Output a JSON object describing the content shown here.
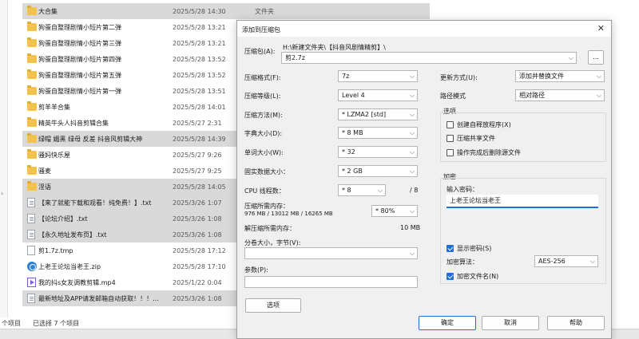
{
  "explorer": {
    "files": [
      {
        "name": "大合集",
        "date": "2025/5/28 14:30",
        "type": "文件夹",
        "icon": "folder-icon",
        "selected": true
      },
      {
        "name": "狗蛋自整理剧情小短片第二弹",
        "date": "2025/5/28 13:21",
        "type": "",
        "icon": "folder-icon",
        "selected": false
      },
      {
        "name": "狗蛋自整理剧情小短片第三弹",
        "date": "2025/5/28 13:21",
        "type": "",
        "icon": "folder-icon",
        "selected": false
      },
      {
        "name": "狗蛋自整理剧情小短片第四弹",
        "date": "2025/5/28 13:52",
        "type": "",
        "icon": "folder-icon",
        "selected": false
      },
      {
        "name": "狗蛋自整理剧情小短片第五弹",
        "date": "2025/5/28 13:52",
        "type": "",
        "icon": "folder-icon",
        "selected": false
      },
      {
        "name": "狗蛋自整理剧情小短片第一弹",
        "date": "2025/5/28 13:51",
        "type": "",
        "icon": "folder-icon",
        "selected": false
      },
      {
        "name": "剪羊羊合集",
        "date": "2025/5/28 14:01",
        "type": "",
        "icon": "folder-icon",
        "selected": false
      },
      {
        "name": "精英牛头人抖音剪辑合集",
        "date": "2025/5/27 2:31",
        "type": "",
        "icon": "folder-icon",
        "selected": false
      },
      {
        "name": "绿帽 媚黑 绿母 反差 抖音风剪辑大神",
        "date": "2025/5/28 14:39",
        "type": "",
        "icon": "folder-icon",
        "selected": true
      },
      {
        "name": "骚妈快乐屋",
        "date": "2025/5/27 9:26",
        "type": "",
        "icon": "folder-icon",
        "selected": false
      },
      {
        "name": "骚麦",
        "date": "2025/5/27 9:25",
        "type": "",
        "icon": "folder-icon",
        "selected": false
      },
      {
        "name": "淫语",
        "date": "2025/5/28 14:05",
        "type": "",
        "icon": "folder-icon",
        "selected": true
      },
      {
        "name": "【来了就能下载和观看！纯免费！】.txt",
        "date": "2025/3/26 1:07",
        "type": "",
        "icon": "txt-icon",
        "selected": true
      },
      {
        "name": "【论坛介绍】.txt",
        "date": "2025/3/26 1:08",
        "type": "",
        "icon": "txt-icon",
        "selected": true
      },
      {
        "name": "【永久地址发布页】.txt",
        "date": "2025/3/26 1:08",
        "type": "",
        "icon": "txt-icon",
        "selected": true
      },
      {
        "name": "剪1.7z.tmp",
        "date": "2025/5/28 17:12",
        "type": "",
        "icon": "tmp-icon",
        "selected": false
      },
      {
        "name": "上老王论坛当老王.zip",
        "date": "2025/5/28 17:10",
        "type": "",
        "icon": "zip-icon",
        "selected": false
      },
      {
        "name": "我的抖s女友调教剪辑.mp4",
        "date": "2025/1/22 0:04",
        "type": "",
        "icon": "mp4-icon",
        "selected": false
      },
      {
        "name": "最新地址及APP请发邮箱自动获取！！！...",
        "date": "2025/3/26 1:08",
        "type": "",
        "icon": "txt-icon",
        "selected": true
      }
    ],
    "status_count": "个项目",
    "status_selected": "已选择 7 个项目"
  },
  "dialog": {
    "title": "添加到压缩包",
    "close_glyph": "✕",
    "archive_label": "压缩包(A):",
    "archive_path": "H:\\新建文件夹\\【抖音风剧情精剪】\\",
    "archive_name": "剪2.7z",
    "browse_label": "...",
    "format_label": "压缩格式(F):",
    "format_value": "7z",
    "level_label": "压缩等级(L):",
    "level_value": "Level 4",
    "method_label": "压缩方法(M):",
    "method_value": "* LZMA2 [std]",
    "dict_label": "字典大小(D):",
    "dict_value": "* 8 MB",
    "word_label": "单词大小(W):",
    "word_value": "* 32",
    "solid_label": "固实数据大小：",
    "solid_value": "* 2 GB",
    "cpu_label": "CPU 线程数：",
    "cpu_value": "* 8",
    "cpu_max": "/ 8",
    "mem_comp_label": "压缩所需内存：",
    "mem_comp_detail": "976 MB / 13012 MB / 16265 MB",
    "mem_comp_value": "* 80%",
    "mem_decomp_label": "解压缩所需内存：",
    "mem_decomp_value": "10 MB",
    "split_label": "分卷大小，字节(V):",
    "params_label": "参数(P):",
    "options_button": "选项",
    "update_label": "更新方式(U):",
    "update_value": "添加并替换文件",
    "path_label": "路径模式",
    "path_value": "相对路径",
    "options_group": "选项",
    "opt_sfx": "创建自释放程序(X)",
    "opt_shared": "压缩共享文件",
    "opt_delete": "操作完成后删除源文件",
    "encrypt_group": "加密",
    "password_label": "输入密码：",
    "password_value": "上老王论坛当老王",
    "show_password": "显示密码(S)",
    "enc_method_label": "加密算法：",
    "enc_method_value": "AES-256",
    "encrypt_names": "加密文件名(N)",
    "ok_button": "确定",
    "cancel_button": "取消",
    "help_button": "帮助"
  },
  "colors": {
    "selection": "#d9d9d9",
    "accent": "#1f6fd6"
  }
}
